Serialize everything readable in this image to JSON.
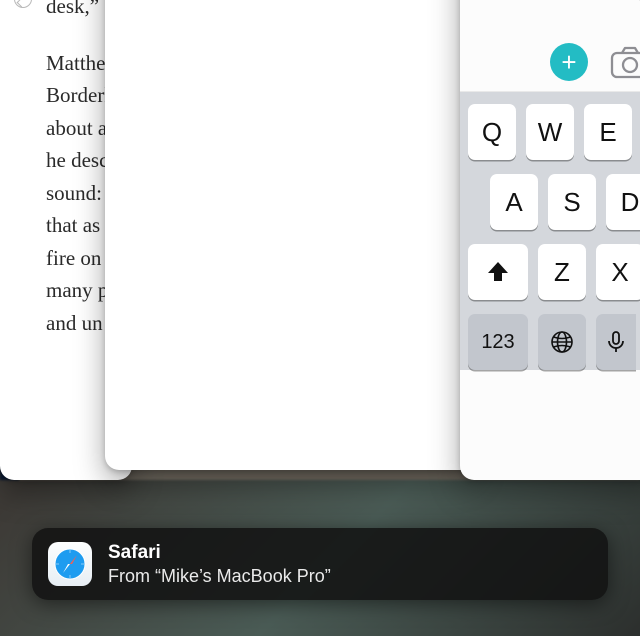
{
  "reader": {
    "para1": "desk,” s",
    "para2": "Matthe\nBorderl\nabout a\nhe desc\nsound:\nthat as\nfire on\nmany p\nand un"
  },
  "notes": {
    "add_label": "+",
    "keys_row1": [
      "Q",
      "W",
      "E"
    ],
    "keys_row2": [
      "A",
      "S",
      "D"
    ],
    "keys_row3_letters": [
      "Z",
      "X"
    ],
    "key_numbers": "123"
  },
  "handoff": {
    "app": "Safari",
    "from": "From “Mike’s MacBook Pro”"
  }
}
